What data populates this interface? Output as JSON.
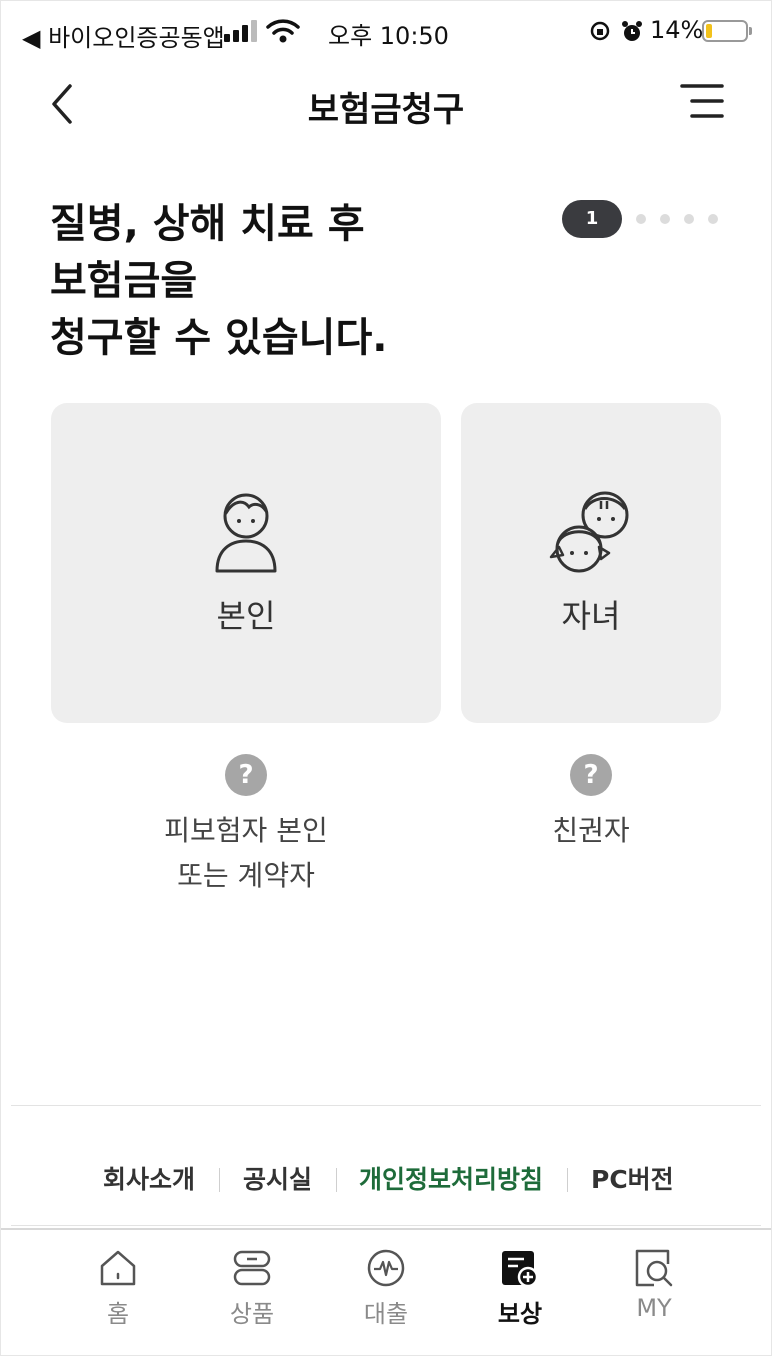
{
  "status_bar": {
    "back_app": "◀ 바이오인증공동앱",
    "time": "오후 10:50",
    "battery": "14%",
    "battery_level": 0.14
  },
  "header": {
    "title": "보험금청구"
  },
  "headline": {
    "line1": "질병, 상해 치료 후",
    "line2": "보험금을",
    "line3": "청구할 수 있습니다."
  },
  "steps": {
    "current": "1",
    "total_dots": 4
  },
  "cards": {
    "self": {
      "label": "본인",
      "help_line1": "피보험자 본인",
      "help_line2": "또는 계약자"
    },
    "child": {
      "label": "자녀",
      "help_line1": "친권자"
    },
    "help_symbol": "?"
  },
  "footer": {
    "links": [
      "회사소개",
      "공시실",
      "개인정보처리방침",
      "PC버전"
    ],
    "highlight_color": "#1e6b3a"
  },
  "tabs": [
    {
      "label": "홈"
    },
    {
      "label": "상품"
    },
    {
      "label": "대출"
    },
    {
      "label": "보상"
    },
    {
      "label": "MY"
    }
  ]
}
